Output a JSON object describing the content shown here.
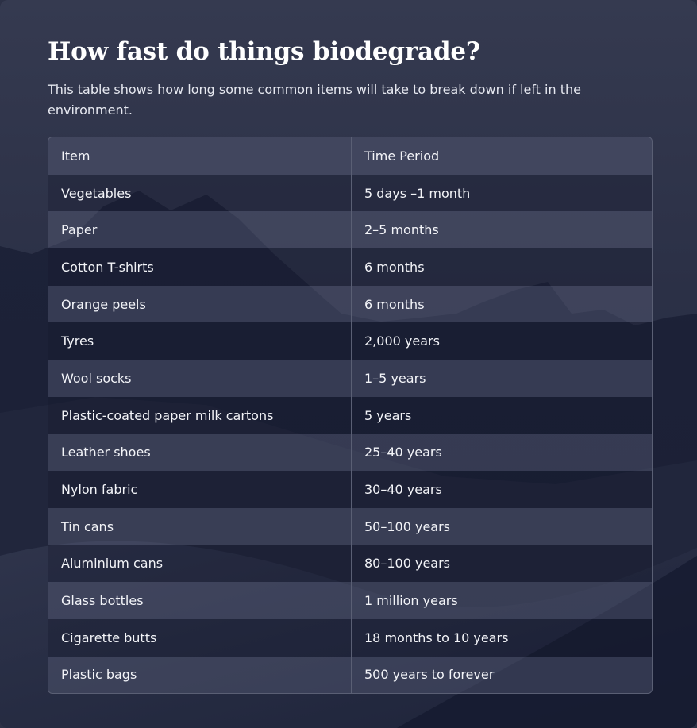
{
  "page": {
    "title": "How fast do things biodegrade?",
    "subtitle": "This table shows how long some common items will take to break down if left in the environment."
  },
  "table": {
    "headers": [
      "Item",
      "Time Period"
    ],
    "rows": [
      [
        "Vegetables",
        "5 days –1 month"
      ],
      [
        "Paper",
        "2–5 months"
      ],
      [
        "Cotton T-shirts",
        "6 months"
      ],
      [
        "Orange peels",
        "6 months"
      ],
      [
        "Tyres",
        "2,000 years"
      ],
      [
        "Wool socks",
        "1–5 years"
      ],
      [
        "Plastic-coated paper milk cartons",
        "5 years"
      ],
      [
        "Leather shoes",
        "25–40 years"
      ],
      [
        "Nylon fabric",
        "30–40 years"
      ],
      [
        "Tin cans",
        "50–100 years"
      ],
      [
        "Aluminium cans",
        "80–100 years"
      ],
      [
        "Glass bottles",
        "1 million years"
      ],
      [
        "Cigarette butts",
        "18 months to 10 years"
      ],
      [
        "Plastic bags",
        "500 years to forever"
      ]
    ]
  },
  "colors": {
    "background": "#2c3146",
    "text": "#ffffff",
    "table_border": "#5a5f74"
  }
}
